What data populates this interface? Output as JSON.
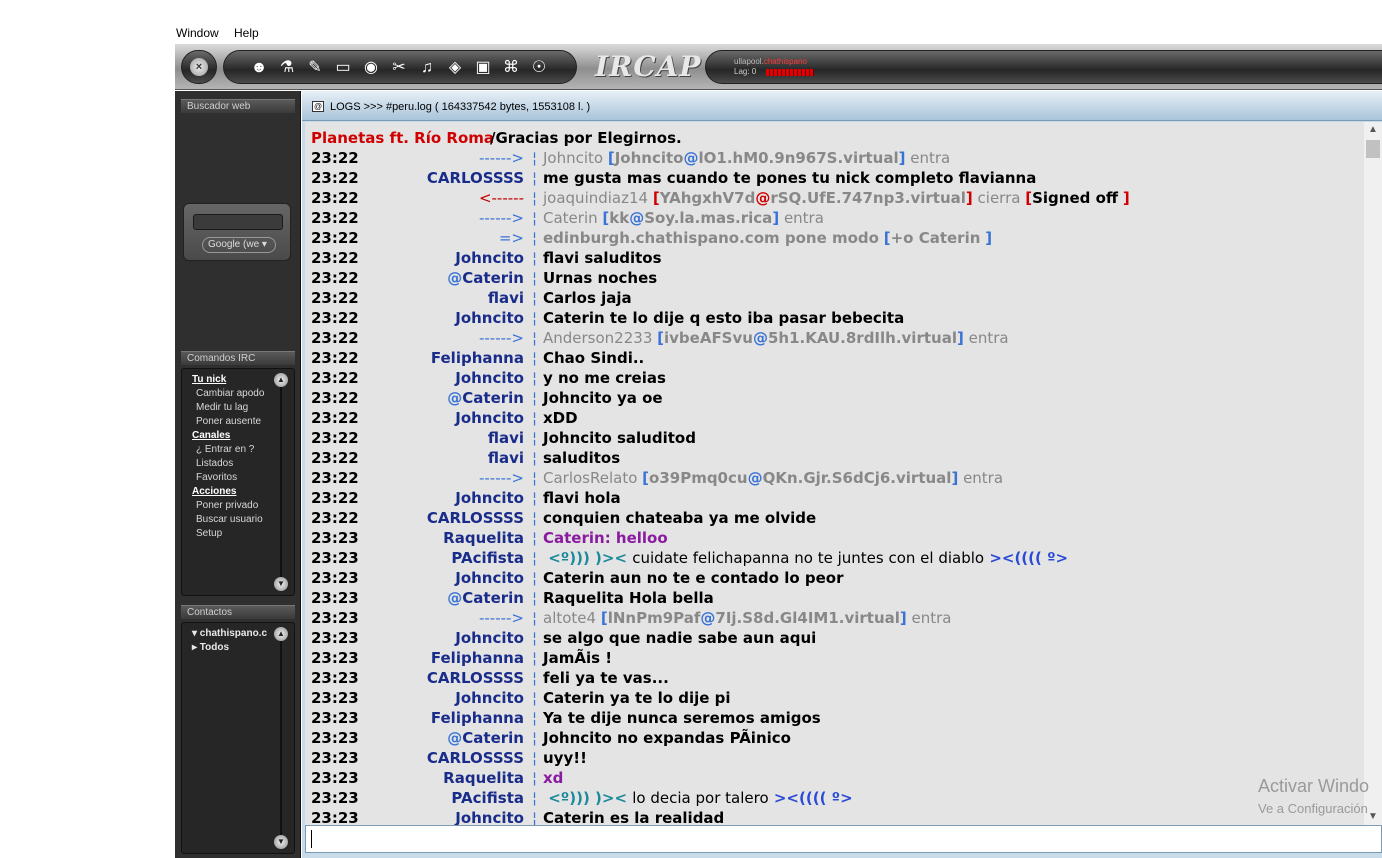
{
  "menu": {
    "window": "Window",
    "help": "Help"
  },
  "toolbar": {
    "close_icon": "×",
    "tools": [
      "☻",
      "⚗",
      "✎",
      "▭",
      "◉",
      "✂",
      "♫",
      "◈",
      "▣",
      "⌘",
      "☉"
    ],
    "logo": "IRCAP",
    "status_user": "ullapool.",
    "status_network": "chathispano",
    "status_lag": "Lag: 0"
  },
  "sidebar": {
    "search_title": "Buscador web",
    "google_select": "Google (we",
    "commands_title": "Comandos IRC",
    "commands": [
      {
        "label": "Tu nick",
        "type": "hdr"
      },
      {
        "label": "Cambiar apodo",
        "type": "sub"
      },
      {
        "label": "Medir tu lag",
        "type": "sub"
      },
      {
        "label": "Poner ausente",
        "type": "sub"
      },
      {
        "label": "Canales",
        "type": "hdr"
      },
      {
        "label": "¿ Entrar en ?",
        "type": "sub"
      },
      {
        "label": "Listados",
        "type": "sub"
      },
      {
        "label": "Favoritos",
        "type": "sub"
      },
      {
        "label": "Acciones",
        "type": "hdr"
      },
      {
        "label": "Poner privado",
        "type": "sub"
      },
      {
        "label": "Buscar usuario",
        "type": "sub"
      },
      {
        "label": "Setup",
        "type": "sub"
      }
    ],
    "contacts_title": "Contactos",
    "contacts": [
      "▾ chathispano.c",
      "▸ Todos"
    ]
  },
  "log": {
    "title": "LOGS >>> #peru.log ( 164337542 bytes, 1553108 l. )",
    "first_line_a": "Planetas ft. Río Roma",
    "first_line_b": " /Gracias por Elegirnos."
  },
  "watermark": {
    "line1": "Activar Windo",
    "line2": "Ve a Configuración"
  }
}
